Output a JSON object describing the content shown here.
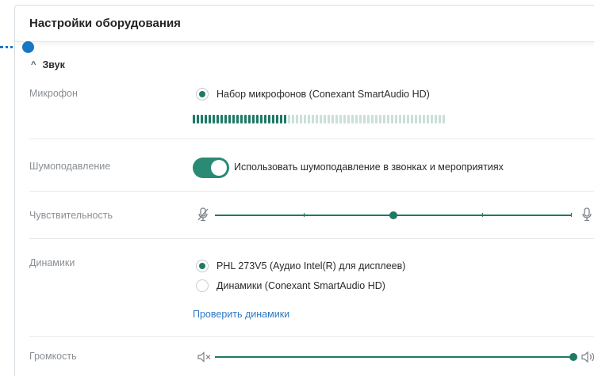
{
  "panel": {
    "title": "Настройки оборудования"
  },
  "section": {
    "title": "Звук",
    "chevron_icon": "chevron-up-icon"
  },
  "microphone": {
    "label": "Микрофон",
    "option": "Набор микрофонов (Conexant SmartAudio HD)",
    "selected": true,
    "level_active_bars": 24,
    "level_total_bars": 64
  },
  "noise": {
    "label": "Шумоподавление",
    "toggle_label": "Использовать шумоподавление в звонках и мероприятиях",
    "enabled": true
  },
  "sensitivity": {
    "label": "Чувствительность",
    "value_fraction": 0.5,
    "min_icon": "mic-muted-icon",
    "max_icon": "mic-icon"
  },
  "speakers": {
    "label": "Динамики",
    "options": [
      {
        "label": "PHL 273V5 (Аудио Intel(R) для дисплеев)",
        "selected": true
      },
      {
        "label": "Динамики (Conexant SmartAudio HD)",
        "selected": false
      }
    ],
    "test_link": "Проверить динамики"
  },
  "volume": {
    "label": "Громкость",
    "value_fraction": 1.0,
    "min_icon": "volume-mute-icon",
    "max_icon": "volume-up-icon"
  },
  "colors": {
    "accent": "#1e7a64",
    "link": "#2f79c4",
    "connector": "#1976c5"
  }
}
